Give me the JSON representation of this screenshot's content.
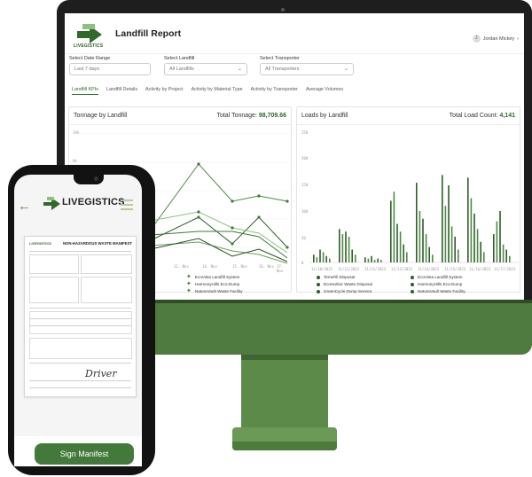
{
  "app": {
    "brand": "LIVEGISTICS",
    "report_title": "Landfill Report",
    "user_initials": "J",
    "user_name": "Jordan Mickey",
    "colors": {
      "accent": "#2f6a2a",
      "series_dark": "#2f5d2a",
      "series_mid": "#4f8a44",
      "series_light": "#8fbf7f"
    }
  },
  "filters": {
    "date_label": "Select Date Range",
    "date_value": "Last 7 days",
    "landfill_label": "Select Landfill",
    "landfill_value": "All Landfills",
    "transporter_label": "Select Transporter",
    "transporter_value": "All Transporters"
  },
  "tabs": [
    "Landfill KPIs",
    "Landfill Details",
    "Activity by Project",
    "Activity by Material Type",
    "Activity by Transporter",
    "Average Volumes"
  ],
  "tonnage_panel": {
    "title": "Tonnage by Landfill",
    "total_label": "Total Tonnage:",
    "total_value": "98,709.66",
    "y_ticks": [
      "10k",
      "8k"
    ],
    "x_ticks": [
      "12. Nov",
      "14. Nov",
      "15. Nov",
      "16. Nov",
      "17. Nov"
    ],
    "legend": [
      "EcoVista Landfill System",
      "HarmonyHills Eco-Dump",
      "NatureVault Waste Facility"
    ]
  },
  "loads_panel": {
    "title": "Loads by Landfill",
    "total_label": "Total Load Count:",
    "total_value": "4,141",
    "y_ticks": [
      "250",
      "200",
      "150",
      "100",
      "50",
      "0"
    ],
    "x_ticks": [
      "11/10/2023",
      "11/11/2023",
      "11/12/2023",
      "11/13/2023",
      "11/14/2023",
      "11/15/2023",
      "11/16/2023",
      "11/17/2023"
    ],
    "legend": [
      "TerraFill Disposal",
      "EcoVista Landfill System",
      "EcoHarbor Waste Disposal",
      "HarmonyHills Eco-Dump",
      "GreenCycle Dump Service",
      "NatureVault Waste Facility"
    ]
  },
  "phone": {
    "back_icon": "arrow-left-icon",
    "menu_icon": "hamburger-icon",
    "doc_brand": "LIVEGISTICS",
    "doc_title": "NON-HAZARDOUS WASTE MANIFEST",
    "signature": "Driver",
    "sign_button": "Sign Manifest"
  }
}
